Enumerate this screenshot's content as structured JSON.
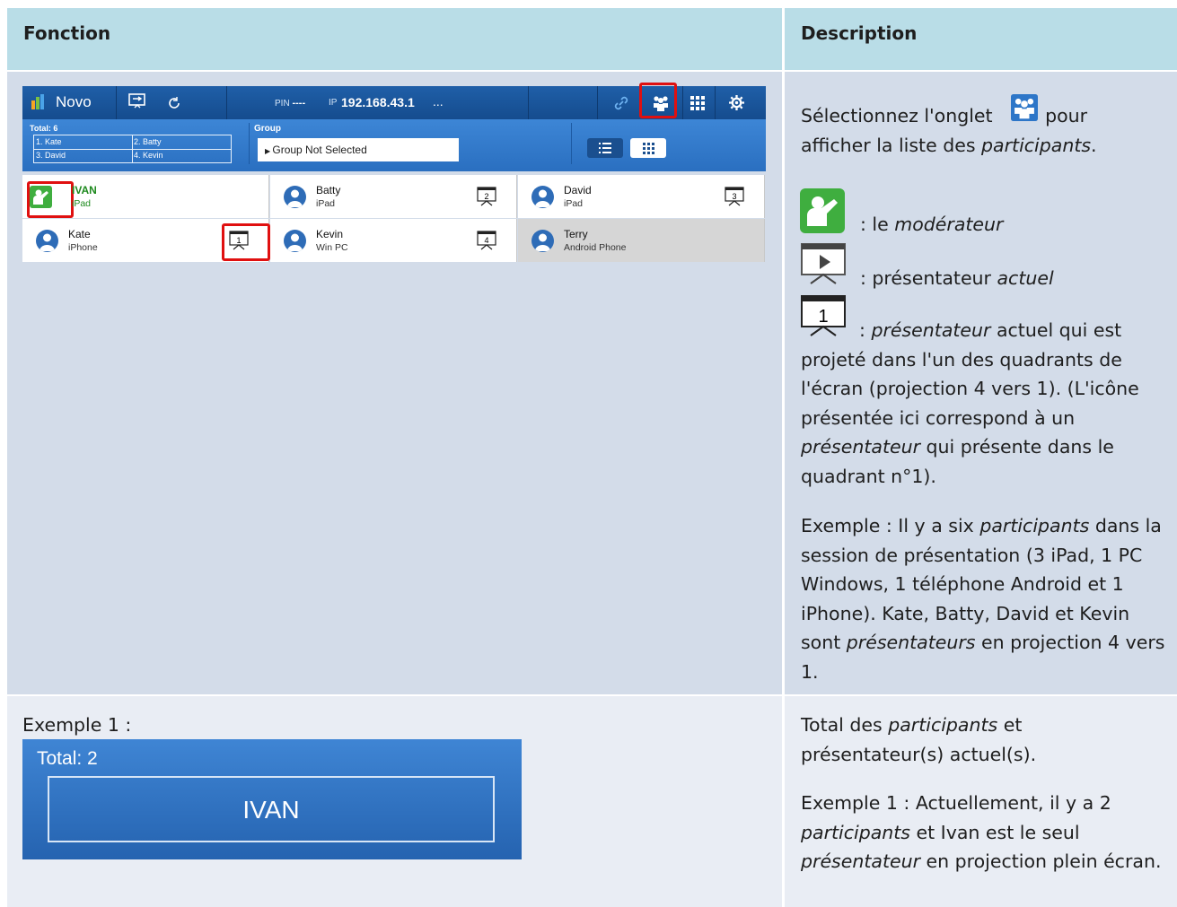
{
  "table": {
    "header": {
      "col1": "Fonction",
      "col2": "Description"
    }
  },
  "app": {
    "name": "Novo",
    "pin_label": "PIN",
    "pin_value": "----",
    "ip_label": "IP",
    "ip_value": "192.168.43.1",
    "more": "...",
    "total": "Total: 6",
    "total_names": [
      "1. Kate",
      "2. Batty",
      "3. David",
      "4. Kevin"
    ],
    "group_label": "Group",
    "group_value": "Group Not Selected",
    "participants": [
      {
        "name": "IVAN",
        "device": "iPad",
        "role": "moderator"
      },
      {
        "name": "Batty",
        "device": "iPad",
        "quadrant": "2"
      },
      {
        "name": "David",
        "device": "iPad",
        "quadrant": "3"
      },
      {
        "name": "Kate",
        "device": "iPhone",
        "quadrant": "1"
      },
      {
        "name": "Kevin",
        "device": "Win PC",
        "quadrant": "4"
      },
      {
        "name": "Terry",
        "device": "Android Phone"
      }
    ]
  },
  "desc": {
    "line1a": "Sélectionnez l'onglet",
    "line1b": "pour",
    "line2a": "afficher la liste des ",
    "line2b": "participants",
    "line2c": ".",
    "mod_a": ": le ",
    "mod_b": "modérateur",
    "pres_a": ": présentateur ",
    "pres_b": "actuel",
    "q_a": ": ",
    "q_b": "présentateur",
    "q_c": " actuel qui est projeté dans l'un des quadrants de l'écran (projection 4 vers 1). (L'icône présentée ici correspond à un ",
    "q_d": "présentateur",
    "q_e": " qui présente dans le quadrant n°1).",
    "ex_a": "Exemple : Il y a six ",
    "ex_b": "participants",
    "ex_c": " dans la session de présentation (3 iPad, 1 PC Windows, 1 téléphone Android et 1 iPhone). Kate, Batty, David et Kevin sont ",
    "ex_d": "présentateurs",
    "ex_e": " en projection 4 vers 1."
  },
  "example1": {
    "label": "Exemple 1 :",
    "total": "Total: 2",
    "name": "IVAN"
  },
  "desc3": {
    "p1a": "Total des ",
    "p1b": "participants",
    "p1c": " et présentateur(s) actuel(s).",
    "p2a": "Exemple 1 : Actuellement, il y a 2 ",
    "p2b": "participants",
    "p2c": " et Ivan est le seul ",
    "p2d": "présentateur",
    "p2e": " en projection plein écran."
  },
  "colors": {
    "header_bg": "#b9dde7",
    "row_bg": "#d3dce9",
    "row3_bg": "#e9edf4",
    "app_blue": "#1f5fa8",
    "highlight": "#e01010"
  }
}
